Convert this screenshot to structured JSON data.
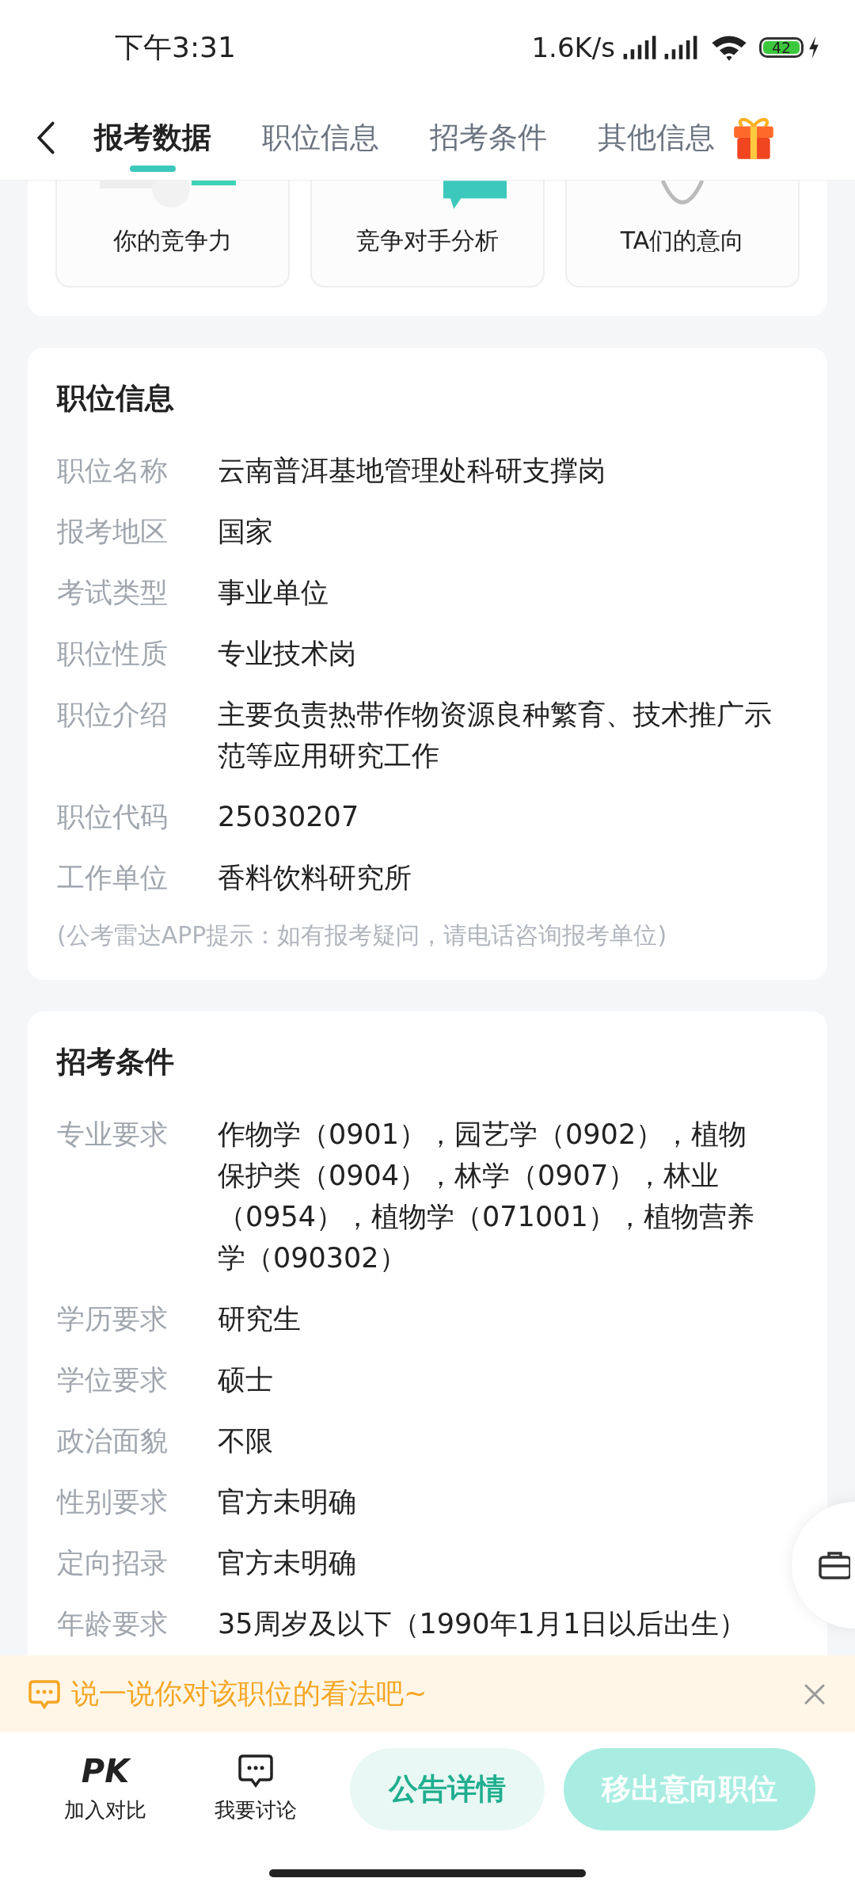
{
  "status_bar": {
    "time": "下午3:31",
    "net_speed": "1.6K/s",
    "battery": "42"
  },
  "nav": {
    "tabs": [
      {
        "label": "报考数据",
        "selected": true
      },
      {
        "label": "职位信息",
        "selected": false
      },
      {
        "label": "招考条件",
        "selected": false
      },
      {
        "label": "其他信息",
        "selected": false
      }
    ]
  },
  "features": [
    {
      "label": "你的竞争力"
    },
    {
      "label": "竞争对手分析"
    },
    {
      "label": "TA们的意向"
    }
  ],
  "job_info": {
    "title": "职位信息",
    "rows": [
      {
        "label": "职位名称",
        "value": "云南普洱基地管理处科研支撑岗"
      },
      {
        "label": "报考地区",
        "value": "国家"
      },
      {
        "label": "考试类型",
        "value": "事业单位"
      },
      {
        "label": "职位性质",
        "value": "专业技术岗"
      },
      {
        "label": "职位介绍",
        "value": "主要负责热带作物资源良种繁育、技术推广示范等应用研究工作"
      },
      {
        "label": "职位代码",
        "value": "25030207"
      },
      {
        "label": "工作单位",
        "value": "香料饮料研究所"
      }
    ],
    "note": "(公考雷达APP提示：如有报考疑问，请电话咨询报考单位)"
  },
  "requirements": {
    "title": "招考条件",
    "rows": [
      {
        "label": "专业要求",
        "value": "作物学（0901），园艺学（0902），植物保护类（0904），林学（0907），林业（0954），植物学（071001），植物营养学（090302）"
      },
      {
        "label": "学历要求",
        "value": "研究生"
      },
      {
        "label": "学位要求",
        "value": "硕士"
      },
      {
        "label": "政治面貌",
        "value": "不限"
      },
      {
        "label": "性别要求",
        "value": "官方未明确"
      },
      {
        "label": "定向招录",
        "value": "官方未明确"
      },
      {
        "label": "年龄要求",
        "value": "35周岁及以下（1990年1月1日以后出生）"
      }
    ]
  },
  "banner": {
    "text": "说一说你对该职位的看法吧~"
  },
  "bottom_bar": {
    "actions": [
      {
        "kind": "pk",
        "glyph": "PK",
        "label": "加入对比"
      },
      {
        "kind": "chat",
        "label": "我要讨论"
      }
    ],
    "buttons": [
      {
        "kind": "secondary",
        "label": "公告详情"
      },
      {
        "kind": "primary",
        "label": "移出意向职位"
      }
    ]
  }
}
